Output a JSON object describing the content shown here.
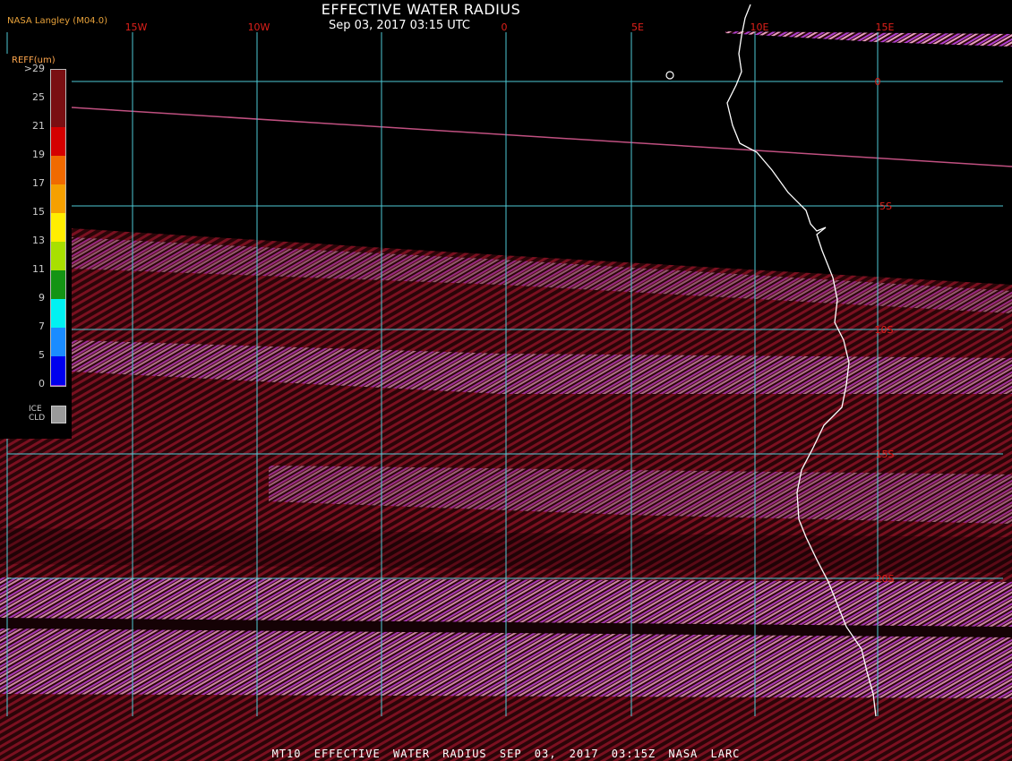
{
  "header": {
    "title": "EFFECTIVE WATER RADIUS",
    "subtitle": "Sep 03, 2017 03:15 UTC",
    "producer": "NASA Langley (M04.0)"
  },
  "map": {
    "longitude_labels": [
      "15W",
      "10W",
      "0",
      "5E",
      "10E",
      "15E"
    ],
    "latitude_labels": [
      "0",
      "5S",
      "10S",
      "15S",
      "20S"
    ],
    "colors": {
      "background": "#000000",
      "grid": "#4ec9d4",
      "grid_label": "#e0201a",
      "coastline": "#ffffff",
      "cloud_dark_red": "#6a0f1a",
      "cloud_magenta": "#b040d0",
      "cloud_pink": "#e8a0c0"
    }
  },
  "legend": {
    "title": "REFF(um)",
    "ticks": [
      ">29",
      "25",
      "21",
      "19",
      "17",
      "15",
      "13",
      "11",
      "9",
      "7",
      "5",
      "0"
    ],
    "colors": [
      "#7a0f12",
      "#7a0f12",
      "#d40000",
      "#f06a00",
      "#f5a000",
      "#ffee00",
      "#a8e000",
      "#149414",
      "#00f2f2",
      "#1a8cff",
      "#0000ee",
      "#9a40e0"
    ],
    "ice_label_1": "ICE",
    "ice_label_2": "CLD",
    "ice_color": "#9a9a9a"
  },
  "footer": {
    "text": "MT10  EFFECTIVE WATER RADIUS  SEP 03, 2017 03:15Z  NASA LARC"
  }
}
